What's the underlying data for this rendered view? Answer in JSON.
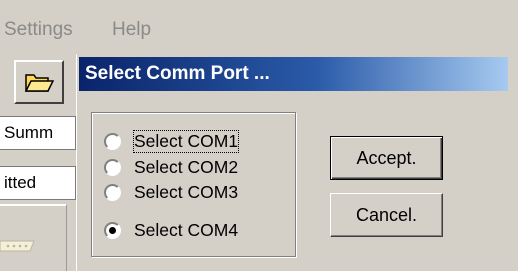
{
  "menu": {
    "settings": "Settings",
    "help": "Help"
  },
  "background": {
    "field1": "Summ",
    "field2": "itted"
  },
  "dialog": {
    "title": "Select Comm Port ...",
    "options": [
      {
        "label": "Select COM1",
        "checked": false,
        "focused": true
      },
      {
        "label": "Select COM2",
        "checked": false,
        "focused": false
      },
      {
        "label": "Select COM3",
        "checked": false,
        "focused": false
      },
      {
        "label": "Select COM4",
        "checked": true,
        "focused": false
      }
    ],
    "accept_label": "Accept.",
    "cancel_label": "Cancel."
  },
  "colors": {
    "titlebar_start": "#0a246a",
    "titlebar_end": "#a6caf0",
    "face": "#d4d0c8"
  },
  "icons": {
    "toolbar": "folder-open-icon"
  }
}
